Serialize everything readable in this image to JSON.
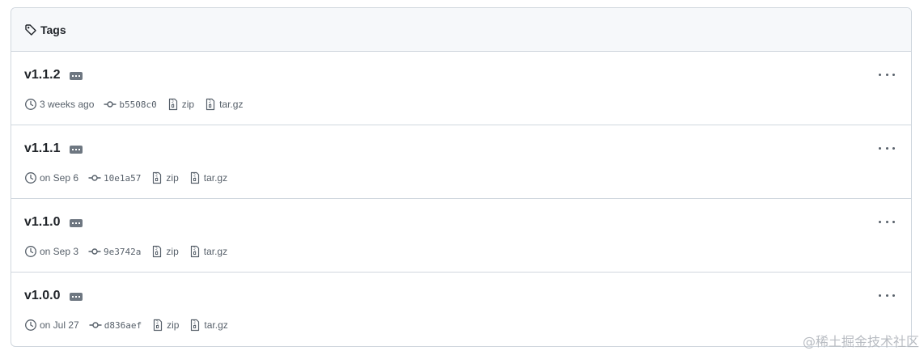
{
  "header": {
    "icon": "tag-icon",
    "title": "Tags"
  },
  "tags": [
    {
      "name": "v1.1.2",
      "date": "3 weeks ago",
      "sha": "b5508c0",
      "zip": "zip",
      "targz": "tar.gz"
    },
    {
      "name": "v1.1.1",
      "date": "on Sep 6",
      "sha": "10e1a57",
      "zip": "zip",
      "targz": "tar.gz"
    },
    {
      "name": "v1.1.0",
      "date": "on Sep 3",
      "sha": "9e3742a",
      "zip": "zip",
      "targz": "tar.gz"
    },
    {
      "name": "v1.0.0",
      "date": "on Jul 27",
      "sha": "d836aef",
      "zip": "zip",
      "targz": "tar.gz"
    }
  ],
  "icons": {
    "clock": "clock-icon",
    "commit": "git-commit-icon",
    "archive": "file-zip-icon",
    "more": "kebab-horizontal-icon"
  },
  "watermark": "@稀土掘金技术社区",
  "colors": {
    "border": "#d0d7de",
    "header_bg": "#f6f8fa",
    "text": "#1f2328",
    "muted": "#57606a"
  }
}
